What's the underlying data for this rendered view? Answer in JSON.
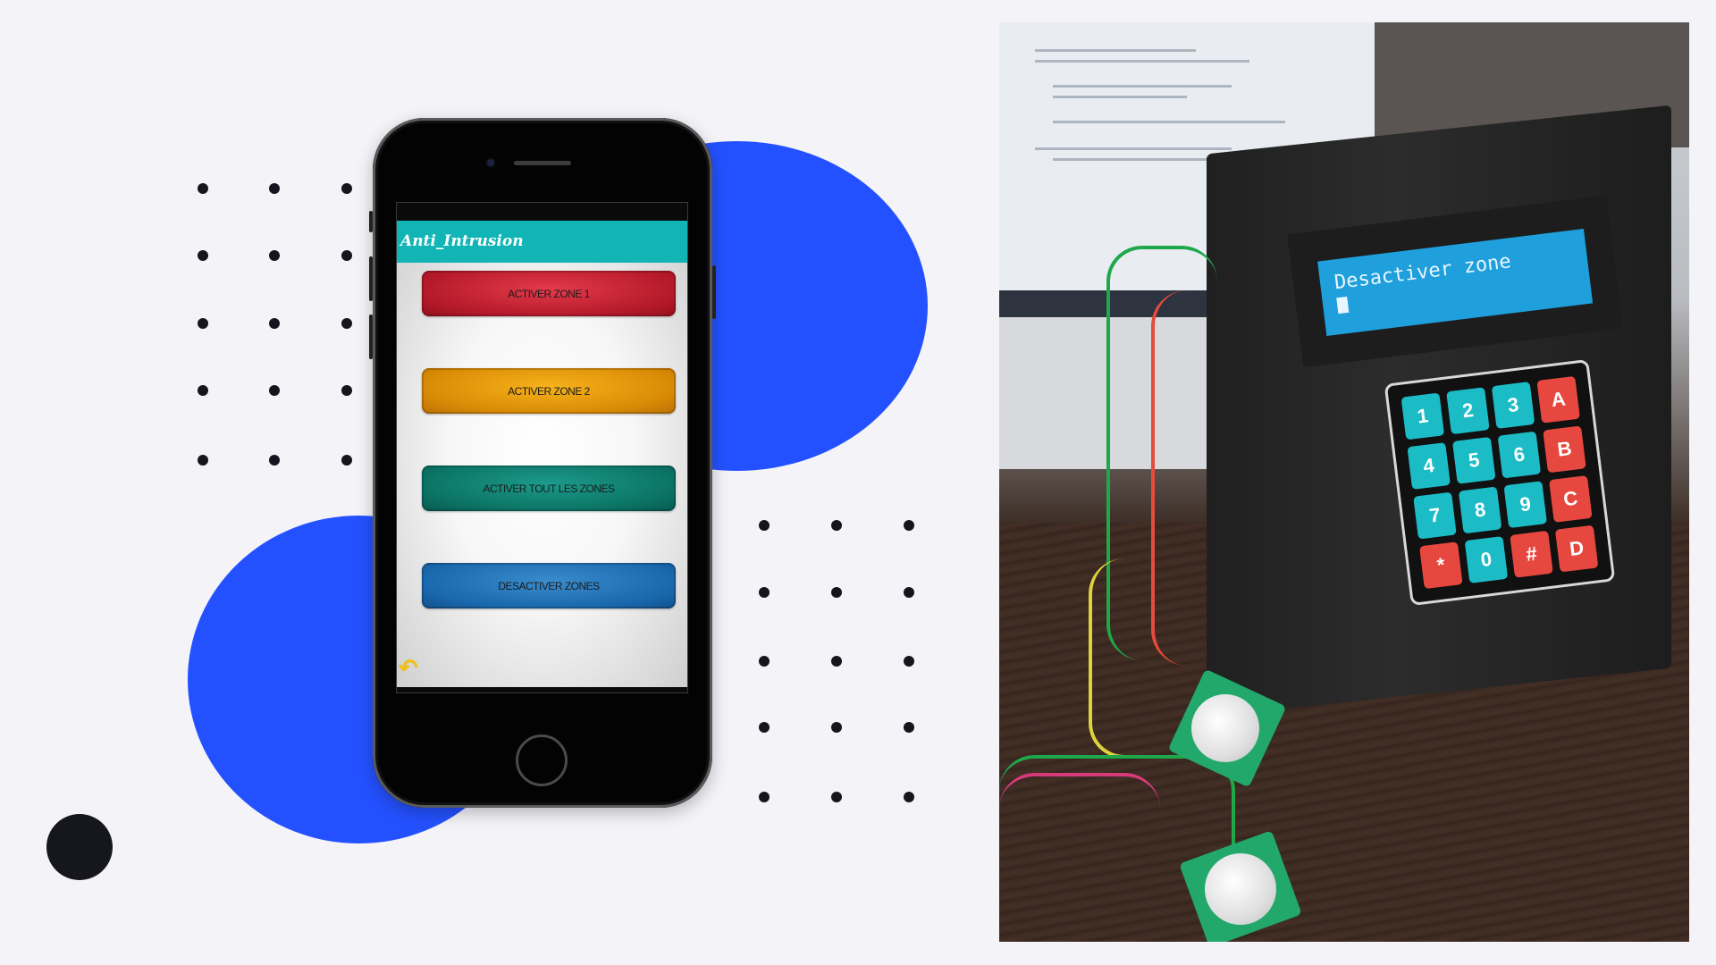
{
  "app": {
    "title": "Anti_Intrusion",
    "buttons": [
      {
        "label": "ACTIVER ZONE 1",
        "color": "#c8202f"
      },
      {
        "label": "ACTIVER ZONE 2",
        "color": "#e39a0b"
      },
      {
        "label": "ACTIVER TOUT LES ZONES",
        "color": "#0e7c6e"
      },
      {
        "label": "DESACTIVER ZONES",
        "color": "#1f6fb3"
      }
    ],
    "back_icon": "back-arrow-icon",
    "appbar_color": "#12b5b5"
  },
  "photo": {
    "lcd_text": "Desactiver zone",
    "keypad": [
      "1",
      "2",
      "3",
      "A",
      "4",
      "5",
      "6",
      "B",
      "7",
      "8",
      "9",
      "C",
      "*",
      "0",
      "#",
      "D"
    ]
  },
  "colors": {
    "accent_blue": "#2451ff",
    "background": "#f4f3f8",
    "dots": "#15151d"
  }
}
